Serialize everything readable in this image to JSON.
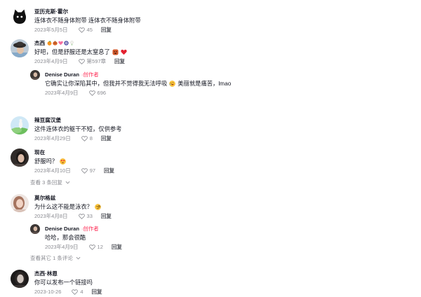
{
  "colors": {
    "background": "#ffffff",
    "text_primary": "#161823",
    "text_secondary": "#8a8b91",
    "creator_badge": "#fe2c55"
  },
  "labels": {
    "reply": "回复"
  },
  "comments": [
    {
      "author": "亚历克斯·霍尔",
      "avatar_icon": "black-cat-avatar",
      "text": "连体衣不随身体附带 连体衣不随身体附带",
      "date": "2023年5月5日",
      "likes": "45"
    },
    {
      "author": "杰西",
      "avatar_icon": "user-photo-avatar",
      "author_emoji_icons": [
        "tangerine-emoji-icon",
        "pumpkin-emoji-icon",
        "sparkling-heart-emoji-icon",
        "b-button-emoji-icon",
        "white-flower-emoji-icon"
      ],
      "text": "好吧，但是舒服还是太窒息了",
      "text_emoji_icons": [
        "hot-face-emoji-icon",
        "red-heart-emoji-icon"
      ],
      "date": "2023年4月9日",
      "likes": "第597章",
      "replies": [
        {
          "author": "Denise Duran",
          "badge": "·创作者",
          "avatar_icon": "user-photo-avatar",
          "text": "它确实让你深陷其中，但我并不觉得我无法呼吸",
          "text_emoji_icons": [
            "rolling-laughing-emoji-icon"
          ],
          "text_after_emoji": "美丽就是痛苦，lmao",
          "date": "2023年4月9日",
          "likes": "696"
        }
      ]
    },
    {
      "author": "辣豆腐汉堡",
      "avatar_icon": "user-photo-avatar",
      "text": "这件连体衣的躯干不短，仅供参考",
      "date": "2023年4月29日",
      "likes": "8"
    },
    {
      "author": "现在",
      "avatar_icon": "user-photo-avatar",
      "text": "舒服吗？",
      "text_emoji_icons": [
        "heart-eyes-emoji-icon"
      ],
      "date": "2023年4月10日",
      "likes": "97",
      "view_replies": "查看 3 条回复"
    },
    {
      "author": "莫尔格兹",
      "avatar_icon": "user-photo-avatar",
      "text": "为什么这不能是泳衣？",
      "text_emoji_icons": [
        "monocle-face-emoji-icon"
      ],
      "date": "2023年4月8日",
      "likes": "33",
      "replies": [
        {
          "author": "Denise Duran",
          "badge": "·创作者",
          "avatar_icon": "user-photo-avatar",
          "text": "哈哈，那会很酷",
          "date": "2023年4月9日",
          "likes": "12"
        }
      ],
      "view_more": "查看其它 1 条评论"
    },
    {
      "author": "杰西·林恩",
      "avatar_icon": "user-photo-avatar",
      "text": "你可以发布一个链接吗",
      "date": "2023-10-26",
      "likes": "4"
    }
  ]
}
